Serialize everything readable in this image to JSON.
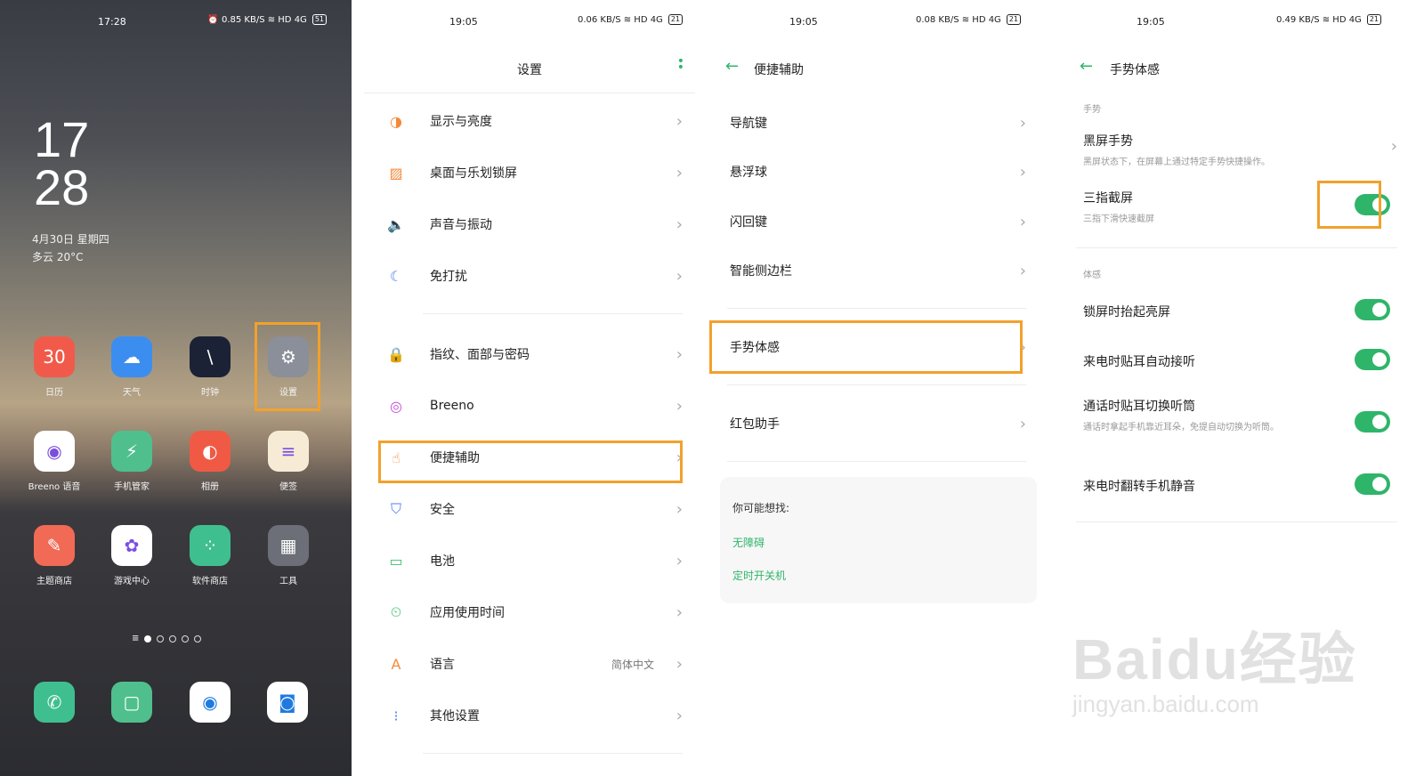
{
  "home": {
    "status_time": "17:28",
    "status_icons": "⏰ 0.85 KB/S  ≋ HD 4G",
    "battery": "51",
    "clock_hour": "17",
    "clock_min": "28",
    "date": "4月30日 星期四",
    "weather": "多云 20°C",
    "apps": [
      {
        "label": "日历",
        "icon": "calendar-icon",
        "glyph": "30",
        "color": "#f15a4a"
      },
      {
        "label": "天气",
        "icon": "weather-icon",
        "glyph": "☁",
        "color": "#3b8ef0"
      },
      {
        "label": "时钟",
        "icon": "clock-icon",
        "glyph": "\\",
        "color": "#1b2236"
      },
      {
        "label": "设置",
        "icon": "gear-icon",
        "glyph": "⚙",
        "color": "#8a8f99"
      },
      {
        "label": "Breeno 语音",
        "icon": "breeno-icon",
        "glyph": "◉",
        "color": "#ffffff"
      },
      {
        "label": "手机管家",
        "icon": "shield-icon",
        "glyph": "⚡",
        "color": "#4fc08d"
      },
      {
        "label": "相册",
        "icon": "photos-icon",
        "glyph": "◐",
        "color": "#f05a45"
      },
      {
        "label": "便签",
        "icon": "notes-icon",
        "glyph": "≡",
        "color": "#f6ecd6"
      },
      {
        "label": "主题商店",
        "icon": "theme-icon",
        "glyph": "✎",
        "color": "#f06a55"
      },
      {
        "label": "游戏中心",
        "icon": "game-icon",
        "glyph": "✿",
        "color": "#ffffff"
      },
      {
        "label": "软件商店",
        "icon": "store-icon",
        "glyph": "⁘",
        "color": "#3fbf8f"
      },
      {
        "label": "工具",
        "icon": "tools-folder-icon",
        "glyph": "▦",
        "color": "#6c6f78"
      }
    ],
    "dock": [
      {
        "icon": "phone-icon",
        "glyph": "✆",
        "color": "#3fbf8f"
      },
      {
        "icon": "messages-icon",
        "glyph": "▢",
        "color": "#4fc08d"
      },
      {
        "icon": "browser-icon",
        "glyph": "◉",
        "color": "#ffffff"
      },
      {
        "icon": "camera-icon",
        "glyph": "◙",
        "color": "#ffffff"
      }
    ]
  },
  "settings": {
    "status_time": "19:05",
    "status_icons": "0.06 KB/S ≋ HD 4G",
    "battery": "21",
    "title": "设置",
    "items": [
      {
        "label": "显示与亮度",
        "icon": "display-icon",
        "glyph": "◑",
        "color": "#f5893a"
      },
      {
        "label": "桌面与乐划锁屏",
        "icon": "wallpaper-icon",
        "glyph": "▨",
        "color": "#f5893a"
      },
      {
        "label": "声音与振动",
        "icon": "sound-icon",
        "glyph": "🔈",
        "color": "#3cbf6a"
      },
      {
        "label": "免打扰",
        "icon": "moon-icon",
        "glyph": "☾",
        "color": "#4d7cf0"
      },
      {
        "label": "指纹、面部与密码",
        "icon": "lock-icon",
        "glyph": "🔒",
        "color": "#4d7cf0"
      },
      {
        "label": "Breeno",
        "icon": "breeno-icon",
        "glyph": "◎",
        "color": "#c84bd6"
      },
      {
        "label": "便捷辅助",
        "icon": "assist-icon",
        "glyph": "☝",
        "color": "#f5893a"
      },
      {
        "label": "安全",
        "icon": "security-icon",
        "glyph": "⛉",
        "color": "#4d7cf0"
      },
      {
        "label": "电池",
        "icon": "battery-icon",
        "glyph": "▭",
        "color": "#3cbf6a"
      },
      {
        "label": "应用使用时间",
        "icon": "screen-time-icon",
        "glyph": "⏲",
        "color": "#3cbf6a"
      },
      {
        "label": "语言",
        "icon": "language-icon",
        "glyph": "A",
        "color": "#f5893a",
        "value": "简体中文"
      },
      {
        "label": "其他设置",
        "icon": "more-icon",
        "glyph": "⁝",
        "color": "#4d7cf0"
      }
    ]
  },
  "assist": {
    "status_time": "19:05",
    "status_icons": "0.08 KB/S ≋ HD 4G",
    "battery": "21",
    "title": "便捷辅助",
    "items": [
      "导航键",
      "悬浮球",
      "闪回键",
      "智能侧边栏",
      "手势体感",
      "红包助手"
    ],
    "suggest_title": "你可能想找:",
    "suggest_links": [
      "无障碍",
      "定时开关机"
    ]
  },
  "gesture": {
    "status_time": "19:05",
    "status_icons": "0.49 KB/S ≋ HD 4G",
    "battery": "21",
    "title": "手势体感",
    "section_gesture": "手势",
    "black_screen_title": "黑屏手势",
    "black_screen_sub": "黑屏状态下，在屏幕上通过特定手势快捷操作。",
    "three_finger_title": "三指截屏",
    "three_finger_sub": "三指下滑快速截屏",
    "section_motion": "体感",
    "motion_items": [
      {
        "title": "锁屏时抬起亮屏",
        "sub": ""
      },
      {
        "title": "来电时贴耳自动接听",
        "sub": ""
      },
      {
        "title": "通话时贴耳切换听筒",
        "sub": "通话时拿起手机靠近耳朵，免提自动切换为听筒。"
      },
      {
        "title": "来电时翻转手机静音",
        "sub": ""
      }
    ],
    "toggles_on": [
      true,
      true,
      true,
      true,
      true
    ]
  },
  "watermark": {
    "line1": "Baidu经验",
    "line2": "jingyan.baidu.com"
  },
  "colors": {
    "accent": "#2fb56a",
    "highlight": "#f2a12c"
  }
}
